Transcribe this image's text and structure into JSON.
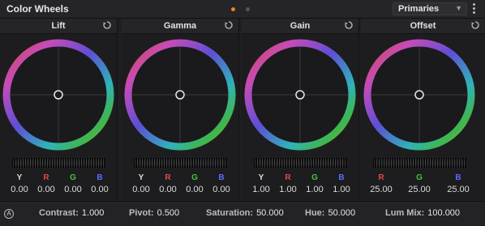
{
  "header": {
    "title": "Color Wheels",
    "mode": "Primaries"
  },
  "colors": {
    "accent": "#e0862c",
    "r": "#e04848",
    "g": "#46c246",
    "b": "#5a6bff"
  },
  "wheels": [
    {
      "name": "Lift",
      "labels": [
        "Y",
        "R",
        "G",
        "B"
      ],
      "values": [
        "0.00",
        "0.00",
        "0.00",
        "0.00"
      ]
    },
    {
      "name": "Gamma",
      "labels": [
        "Y",
        "R",
        "G",
        "B"
      ],
      "values": [
        "0.00",
        "0.00",
        "0.00",
        "0.00"
      ]
    },
    {
      "name": "Gain",
      "labels": [
        "Y",
        "R",
        "G",
        "B"
      ],
      "values": [
        "1.00",
        "1.00",
        "1.00",
        "1.00"
      ]
    },
    {
      "name": "Offset",
      "labels": [
        "R",
        "G",
        "B"
      ],
      "values": [
        "25.00",
        "25.00",
        "25.00"
      ]
    }
  ],
  "footer": {
    "auto_label": "A",
    "contrast_label": "Contrast:",
    "contrast_value": "1.000",
    "pivot_label": "Pivot:",
    "pivot_value": "0.500",
    "saturation_label": "Saturation:",
    "saturation_value": "50.000",
    "hue_label": "Hue:",
    "hue_value": "50.000",
    "lummix_label": "Lum Mix:",
    "lummix_value": "100.000"
  }
}
